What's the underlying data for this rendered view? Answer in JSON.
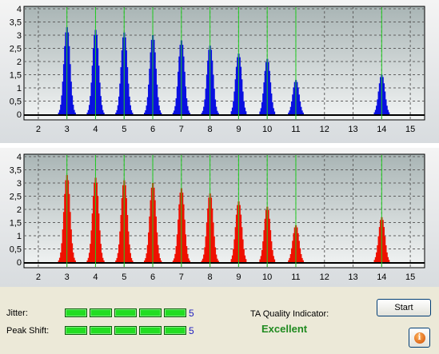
{
  "status": {
    "jitter_label": "Jitter:",
    "jitter_value": "5",
    "jitter_level": 5,
    "peak_shift_label": "Peak Shift:",
    "peak_shift_value": "5",
    "peak_shift_level": 5,
    "meter_max": 5,
    "quality_label": "TA Quality Indicator:",
    "quality_value": "Excellent",
    "start_label": "Start",
    "info_icon": "info-icon"
  },
  "colors": {
    "top_series": "#0a10e0",
    "bottom_series": "#ee1000",
    "marker_lines": "#22cc22",
    "quality_text": "#1f8a1f",
    "meter_segment": "#22dd22"
  },
  "chart_data": [
    {
      "type": "bar",
      "ylim": [
        0,
        4
      ],
      "yticks": [
        "0",
        "0,5",
        "1",
        "1,5",
        "2",
        "2,5",
        "3",
        "3,5",
        "4"
      ],
      "xlim": [
        1.5,
        15.5
      ],
      "xticks": [
        "2",
        "3",
        "4",
        "5",
        "6",
        "7",
        "8",
        "9",
        "10",
        "11",
        "12",
        "13",
        "14",
        "15"
      ],
      "reference_lines": [
        3,
        4,
        5,
        6,
        7,
        8,
        9,
        10,
        11,
        14
      ],
      "grid": true,
      "peaks": [
        {
          "center": 3,
          "height": 3.3
        },
        {
          "center": 4,
          "height": 3.2
        },
        {
          "center": 5,
          "height": 3.1
        },
        {
          "center": 6,
          "height": 3.0
        },
        {
          "center": 7,
          "height": 2.8
        },
        {
          "center": 8,
          "height": 2.6
        },
        {
          "center": 9,
          "height": 2.3
        },
        {
          "center": 10,
          "height": 2.1
        },
        {
          "center": 11,
          "height": 1.3
        },
        {
          "center": 14,
          "height": 1.5
        }
      ]
    },
    {
      "type": "bar",
      "ylim": [
        0,
        4
      ],
      "yticks": [
        "0",
        "0,5",
        "1",
        "1,5",
        "2",
        "2,5",
        "3",
        "3,5",
        "4"
      ],
      "xlim": [
        1.5,
        15.5
      ],
      "xticks": [
        "2",
        "3",
        "4",
        "5",
        "6",
        "7",
        "8",
        "9",
        "10",
        "11",
        "12",
        "13",
        "14",
        "15"
      ],
      "reference_lines": [
        3,
        4,
        5,
        6,
        7,
        8,
        9,
        10,
        11,
        14
      ],
      "grid": true,
      "peaks": [
        {
          "center": 3,
          "height": 3.3
        },
        {
          "center": 4,
          "height": 3.2
        },
        {
          "center": 5,
          "height": 3.1
        },
        {
          "center": 6,
          "height": 3.0
        },
        {
          "center": 7,
          "height": 2.8
        },
        {
          "center": 8,
          "height": 2.6
        },
        {
          "center": 9,
          "height": 2.3
        },
        {
          "center": 10,
          "height": 2.1
        },
        {
          "center": 11,
          "height": 1.4
        },
        {
          "center": 14,
          "height": 1.7
        }
      ]
    }
  ]
}
